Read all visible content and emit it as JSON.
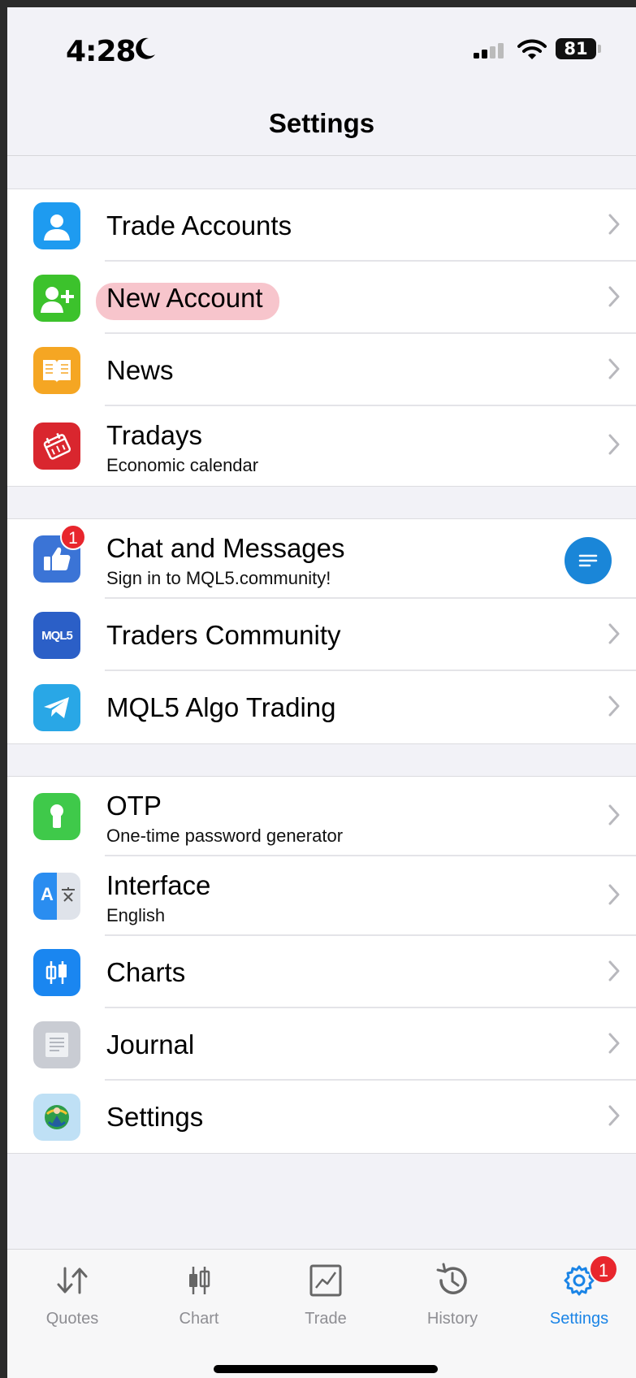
{
  "status_bar": {
    "time": "4:28",
    "battery": "81"
  },
  "nav": {
    "title": "Settings"
  },
  "groups": [
    {
      "items": [
        {
          "label": "Trade Accounts",
          "icon": "person-icon",
          "icon_color": "#1e9bf0"
        },
        {
          "label": "New Account",
          "icon": "person-plus-icon",
          "icon_color": "#3cc22c",
          "highlighted": true
        },
        {
          "label": "News",
          "icon": "book-icon",
          "icon_color": "#f5a623"
        },
        {
          "label": "Tradays",
          "subtitle": "Economic calendar",
          "icon": "calendar-icon",
          "icon_color": "#d9262e"
        }
      ]
    },
    {
      "items": [
        {
          "label": "Chat and Messages",
          "subtitle": "Sign in to MQL5.community!",
          "icon": "thumbs-up-icon",
          "icon_color": "#3b74d6",
          "badge": "1"
        },
        {
          "label": "Traders Community",
          "icon": "mql5-logo-icon",
          "icon_color": "#2b5fc7",
          "icon_text": "MQL5"
        },
        {
          "label": "MQL5 Algo Trading",
          "icon": "telegram-icon",
          "icon_color": "#29a7e6"
        }
      ]
    },
    {
      "items": [
        {
          "label": "OTP",
          "subtitle": "One-time password generator",
          "icon": "keyhole-icon",
          "icon_color": "#3fc94a"
        },
        {
          "label": "Interface",
          "subtitle": "English",
          "icon": "translate-icon",
          "icon_color": "#2a8df0",
          "icon_text": "A"
        },
        {
          "label": "Charts",
          "icon": "candlestick-icon",
          "icon_color": "#1a86f0"
        },
        {
          "label": "Journal",
          "icon": "document-lines-icon",
          "icon_color": "#c9ccd3"
        },
        {
          "label": "Settings",
          "icon": "metatrader-logo-icon",
          "icon_color": "#bfe0f5"
        }
      ]
    }
  ],
  "tabs": [
    {
      "label": "Quotes",
      "icon": "quotes-icon"
    },
    {
      "label": "Chart",
      "icon": "chart-icon"
    },
    {
      "label": "Trade",
      "icon": "trade-icon"
    },
    {
      "label": "History",
      "icon": "history-icon"
    },
    {
      "label": "Settings",
      "icon": "gear-icon",
      "active": true,
      "badge": "1"
    }
  ],
  "colors": {
    "accent": "#1a84e6",
    "badge": "#e8262d",
    "highlight": "#f7c5cc"
  }
}
